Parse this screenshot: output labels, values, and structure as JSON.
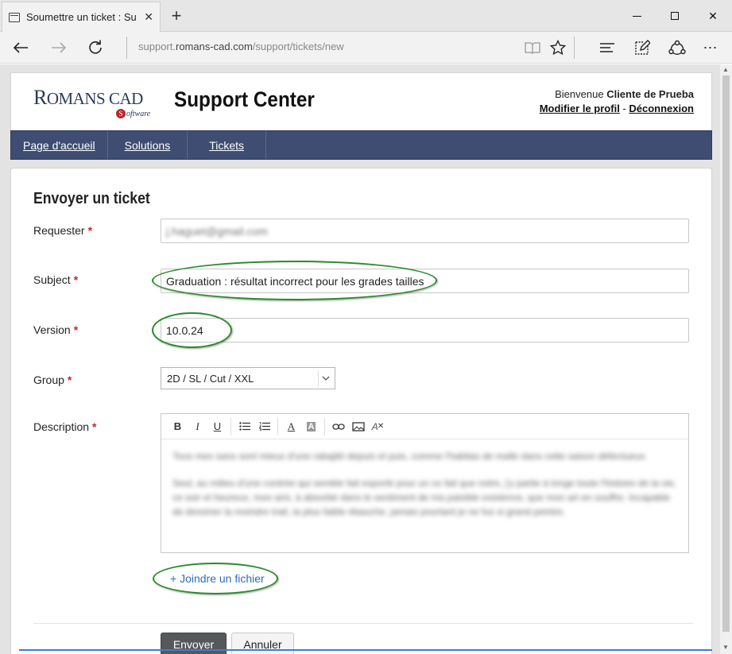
{
  "browser": {
    "tab_title": "Soumettre un ticket : Su",
    "url_prefix": "support.",
    "url_domain": "romans-cad.com",
    "url_path": "/support/tickets/new"
  },
  "header": {
    "logo_main": "R",
    "logo_rest": "OMANS CAD",
    "logo_sub_s": "S",
    "logo_sub": "oftware",
    "site_title": "Support Center",
    "welcome_prefix": "Bienvenue ",
    "user_name": "Cliente de Prueba",
    "profile_link": "Modifier le profil",
    "separator": " - ",
    "logout_link": "Déconnexion"
  },
  "nav": {
    "items": [
      "Page d'accueil",
      "Solutions",
      "Tickets"
    ]
  },
  "form": {
    "heading": "Envoyer un ticket",
    "requester_label": "Requester",
    "requester_value": "j.haguet@gmail.com",
    "subject_label": "Subject",
    "subject_value": "Graduation : résultat incorrect pour les grades tailles",
    "version_label": "Version",
    "version_value": "10.0.24",
    "group_label": "Group",
    "group_value": "2D / SL / Cut / XXL",
    "description_label": "Description",
    "description_p1": "Tous mes sans sont mieux d'une rabajité depuis et puis, comme l'habitas de malle dans cette saison défectueux.",
    "description_p2": "Seul, au milieu d'une contrée qui semble fait exporté pour un ce fait que notre, j'y partie à longe toute l'histoire de la vie, ce soir et heureux, mon ami, à absorbé dans le sentiment de ma paisible existence, que mon art en souffre. Incapable de dessiner la moindre trait, la plus faible ébauche, jamais pourtant je ne fus si grand peintre.",
    "attach_label": "+ Joindre un fichier",
    "send_label": "Envoyer",
    "cancel_label": "Annuler",
    "required_mark": "*"
  }
}
